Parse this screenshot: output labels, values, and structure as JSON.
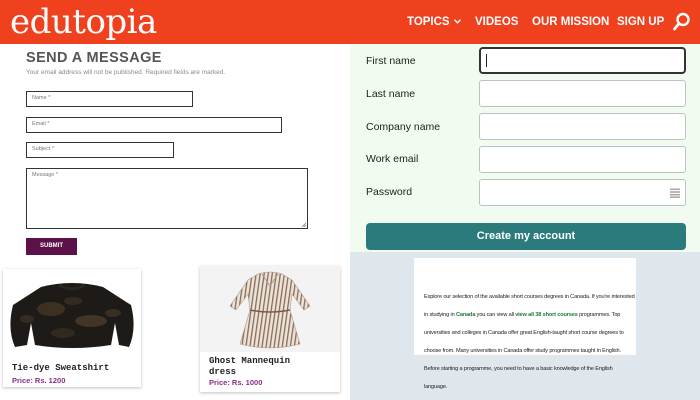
{
  "header": {
    "logo": "edutopia",
    "nav": {
      "topics": "TOPICS",
      "videos": "VIDEOS",
      "mission": "OUR MISSION",
      "signup": "SIGN UP"
    },
    "search_icon": "search-icon",
    "color": "#f0411f"
  },
  "message_form": {
    "title": "SEND A MESSAGE",
    "subtitle": "Your email address will not be published. Required fields are marked.",
    "name_placeholder": "Name *",
    "email_placeholder": "Email *",
    "subject_placeholder": "Subject *",
    "message_placeholder": "Message *",
    "submit_label": "SUBMIT",
    "submit_color": "#5c1149"
  },
  "signup_form": {
    "fields": [
      {
        "label": "First name",
        "value": ""
      },
      {
        "label": "Last name",
        "value": ""
      },
      {
        "label": "Company name",
        "value": ""
      },
      {
        "label": "Work email",
        "value": ""
      },
      {
        "label": "Password",
        "value": ""
      }
    ],
    "button_label": "Create my account",
    "button_color": "#2b7b7d",
    "background": "#f1fbef"
  },
  "info": {
    "line1": "Explore our selection of the available short courses degrees in Canada. If you're interested in studying in ",
    "link1": "Canada",
    "line2": " you can view all ",
    "link2": "view all 38 short courses",
    "line3": " programmes. Top universities and colleges in Canada offer great English-taught short course degrees to choose from. Many universities in Canada offer study programmes taught in English. Before starting a programme, you need to have a basic knowledge of the English language."
  },
  "products": [
    {
      "name": "Tie-dye Sweatshirt",
      "price": "Price: Rs. 1200"
    },
    {
      "name": "Ghost Mannequin dress",
      "price": "Price: Rs. 1000"
    }
  ]
}
